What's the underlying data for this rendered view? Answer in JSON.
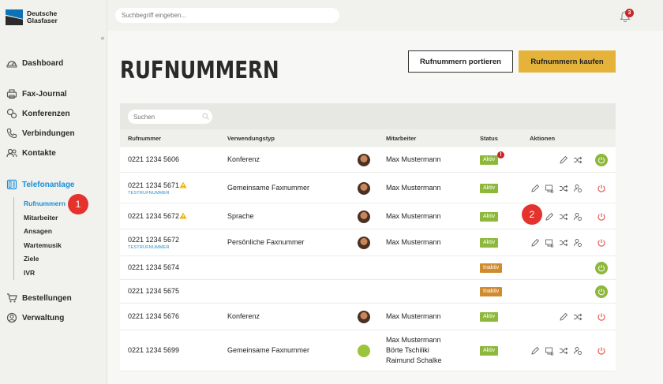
{
  "brand": {
    "line1": "Deutsche",
    "line2": "Glasfaser"
  },
  "topbar": {
    "search_placeholder": "Suchbegriff eingeben...",
    "notifications_count": "3"
  },
  "sidebar": {
    "items": [
      {
        "label": "Dashboard",
        "icon": "dashboard-icon"
      },
      {
        "label": "Fax-Journal",
        "icon": "fax-icon"
      },
      {
        "label": "Konferenzen",
        "icon": "conference-icon"
      },
      {
        "label": "Verbindungen",
        "icon": "phone-icon"
      },
      {
        "label": "Kontakte",
        "icon": "contacts-icon"
      },
      {
        "label": "Telefonanlage",
        "icon": "phone-system-icon"
      },
      {
        "label": "Bestellungen",
        "icon": "cart-icon"
      },
      {
        "label": "Verwaltung",
        "icon": "admin-icon"
      }
    ],
    "subitems": [
      "Rufnummern",
      "Mitarbeiter",
      "Ansagen",
      "Wartemusik",
      "Ziele",
      "IVR"
    ]
  },
  "markers": {
    "m1": "1",
    "m2": "2"
  },
  "page": {
    "title": "RUFNUMMERN",
    "btn_port": "Rufnummern portieren",
    "btn_buy": "Rufnummern kaufen"
  },
  "table": {
    "search_placeholder": "Suchen",
    "headers": {
      "number": "Rufnummer",
      "type": "Verwendungstyp",
      "employee": "Mitarbeiter",
      "status": "Status",
      "actions": "Aktionen"
    },
    "test_label": "TESTRUFNUMMER",
    "rows": [
      {
        "number": "0221 1234 5606",
        "type": "Konferenz",
        "employee": "Max Mustermann",
        "status": "Aktiv"
      },
      {
        "number": "0221 1234 5671",
        "type": "Gemeinsame Faxnummer",
        "employee": "Max Mustermann",
        "status": "Aktiv"
      },
      {
        "number": "0221 1234 5672",
        "type": "Sprache",
        "employee": "Max Mustermann",
        "status": "Aktiv"
      },
      {
        "number": "0221 1234 5672",
        "type": "Persönliche Faxnummer",
        "employee": "Max Mustermann",
        "status": "Aktiv"
      },
      {
        "number": "0221 1234 5674",
        "type": "",
        "employee": "",
        "status": "Inaktiv"
      },
      {
        "number": "0221 1234 5675",
        "type": "",
        "employee": "",
        "status": "Inaktiv"
      },
      {
        "number": "0221 1234 5676",
        "type": "Konferenz",
        "employee": "Max Mustermann",
        "status": "Aktiv"
      },
      {
        "number": "0221 1234 5699",
        "type": "Gemeinsame Faxnummer",
        "employee_lines": [
          "Max Mustermann",
          "Börte Tschiliki",
          "Raimund Schalke"
        ],
        "status": "Aktiv"
      }
    ]
  },
  "colors": {
    "accent": "#e6b33a",
    "active_nav": "#1a8fd6",
    "status_active": "#8db83a",
    "status_inactive": "#d08a30",
    "alert": "#c62828"
  }
}
